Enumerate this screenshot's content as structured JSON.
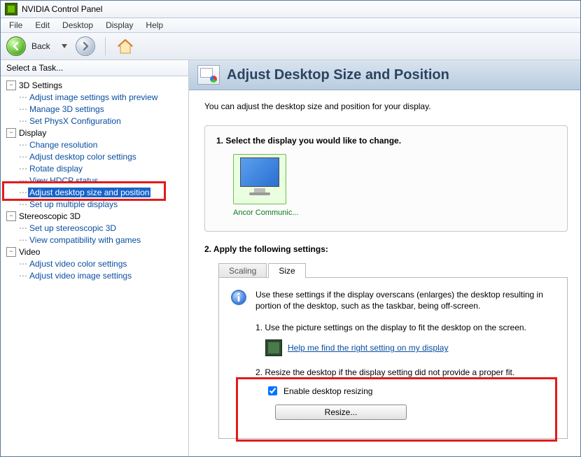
{
  "window": {
    "title": "NVIDIA Control Panel"
  },
  "menu": {
    "file": "File",
    "edit": "Edit",
    "desktop": "Desktop",
    "display": "Display",
    "help": "Help"
  },
  "toolbar": {
    "back": "Back"
  },
  "sidebar": {
    "header": "Select a Task...",
    "groups": {
      "g3d": "3D Settings",
      "display": "Display",
      "stereo": "Stereoscopic 3D",
      "video": "Video"
    },
    "items": {
      "g3d": [
        "Adjust image settings with preview",
        "Manage 3D settings",
        "Set PhysX Configuration"
      ],
      "display": [
        "Change resolution",
        "Adjust desktop color settings",
        "Rotate display",
        "View HDCP status",
        "Adjust desktop size and position",
        "Set up multiple displays"
      ],
      "stereo": [
        "Set up stereoscopic 3D",
        "View compatibility with games"
      ],
      "video": [
        "Adjust video color settings",
        "Adjust video image settings"
      ]
    }
  },
  "page": {
    "title": "Adjust Desktop Size and Position",
    "intro": "You can adjust the desktop size and position for your display.",
    "step1": "1. Select the display you would like to change.",
    "monitor_label": "Ancor Communic...",
    "step2": "2. Apply the following settings:",
    "tabs": {
      "scaling": "Scaling",
      "size": "Size"
    },
    "info": "Use these settings if the display overscans (enlarges) the desktop resulting in portion of the desktop, such as the taskbar, being off-screen.",
    "sub1": "1. Use the picture settings on the display to fit the desktop on the screen.",
    "help_link": "Help me find the right setting on my display",
    "sub2": "2. Resize the desktop if the display setting did not provide a proper fit.",
    "enable_resize": "Enable desktop resizing",
    "resize_btn": "Resize..."
  }
}
